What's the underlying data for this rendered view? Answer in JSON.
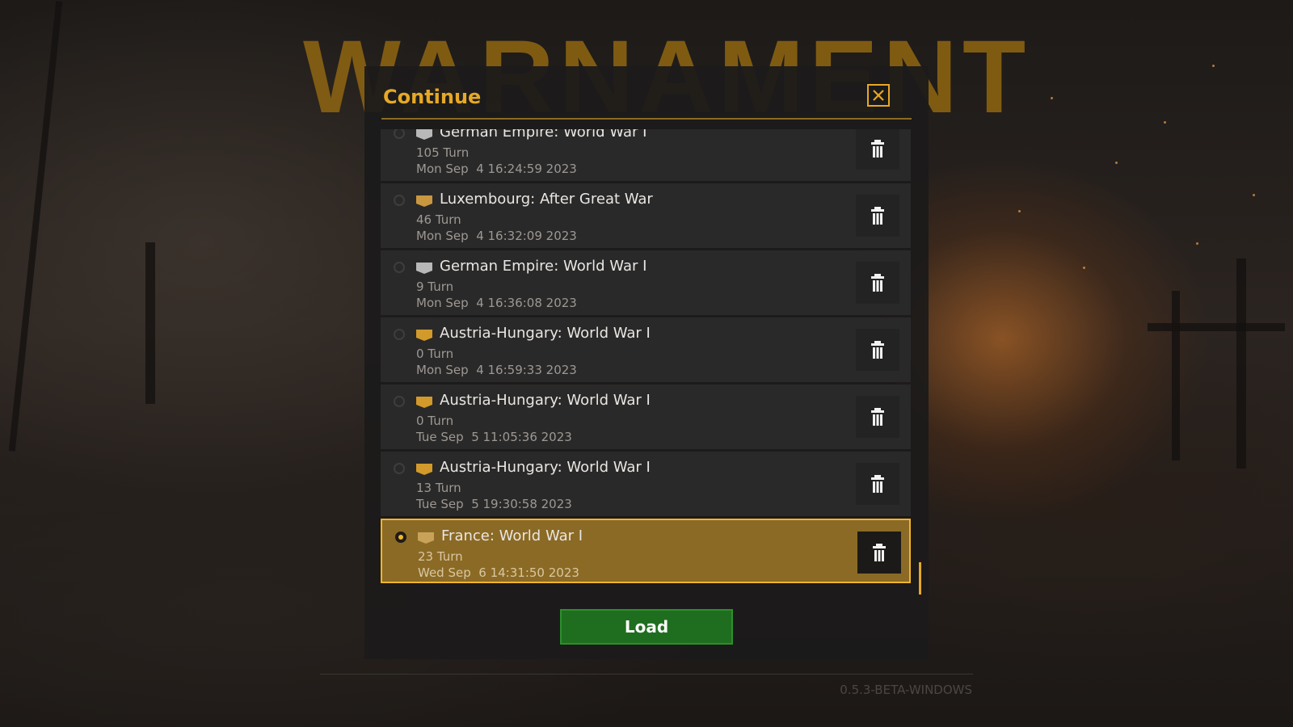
{
  "brand": {
    "title": "WARNAMENT"
  },
  "dialog": {
    "title": "Continue",
    "close_icon": "close-icon",
    "load_label": "Load"
  },
  "saves": [
    {
      "name": "German Empire: World War I",
      "turn": "105 Turn",
      "date": "Mon Sep  4 16:24:59 2023",
      "flag_color": "#b8b8b8",
      "selected": false
    },
    {
      "name": "Luxembourg: After Great War",
      "turn": "46 Turn",
      "date": "Mon Sep  4 16:32:09 2023",
      "flag_color": "#c9973f",
      "selected": false
    },
    {
      "name": "German Empire: World War I",
      "turn": "9 Turn",
      "date": "Mon Sep  4 16:36:08 2023",
      "flag_color": "#b8b8b8",
      "selected": false
    },
    {
      "name": "Austria-Hungary: World War I",
      "turn": "0 Turn",
      "date": "Mon Sep  4 16:59:33 2023",
      "flag_color": "#d19a2a",
      "selected": false
    },
    {
      "name": "Austria-Hungary: World War I",
      "turn": "0 Turn",
      "date": "Tue Sep  5 11:05:36 2023",
      "flag_color": "#d19a2a",
      "selected": false
    },
    {
      "name": "Austria-Hungary: World War I",
      "turn": "13 Turn",
      "date": "Tue Sep  5 19:30:58 2023",
      "flag_color": "#d19a2a",
      "selected": false
    },
    {
      "name": "France: World War I",
      "turn": "23 Turn",
      "date": "Wed Sep  6 14:31:50 2023",
      "flag_color": "#c9a25a",
      "selected": true
    }
  ],
  "footer": {
    "version": "0.5.3-BETA-WINDOWS"
  },
  "colors": {
    "accent": "#e6a826",
    "load_green": "#1f6e1f",
    "selected_row": "#8b6a25"
  }
}
